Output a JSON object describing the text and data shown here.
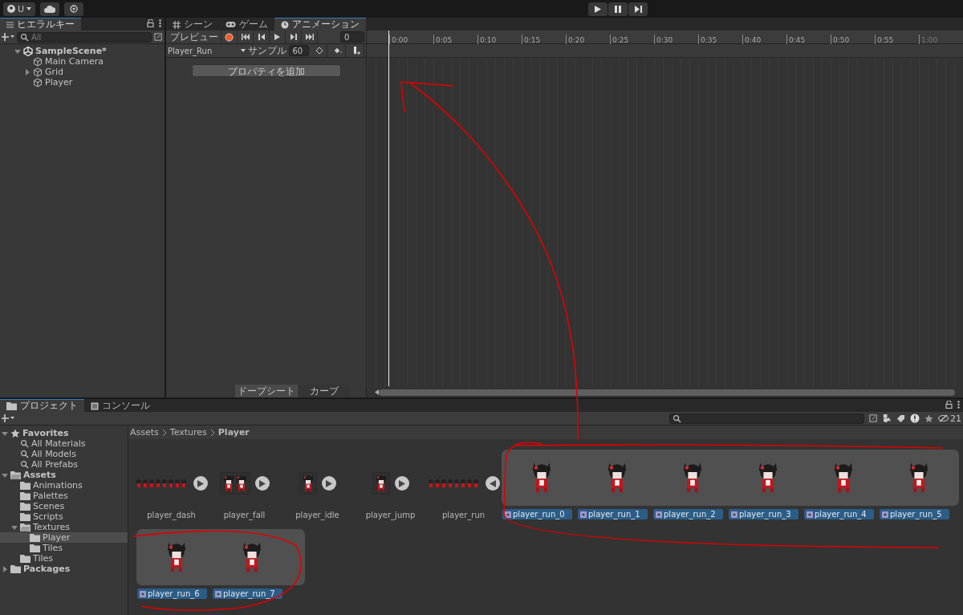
{
  "toolbar": {
    "account": "U"
  },
  "hierarchy": {
    "tab": "ヒエラルキー",
    "search": {
      "placeholder": "All"
    },
    "items": [
      {
        "label": "SampleScene*",
        "kind": "scene",
        "expanded": true,
        "children": [
          {
            "label": "Main Camera",
            "kind": "object"
          },
          {
            "label": "Grid",
            "kind": "object",
            "expanded": false
          },
          {
            "label": "Player",
            "kind": "object"
          }
        ]
      }
    ]
  },
  "animation": {
    "tabs": [
      {
        "label": "シーン",
        "kind": "scene",
        "selected": false
      },
      {
        "label": "ゲーム",
        "kind": "game",
        "selected": false
      },
      {
        "label": "アニメーション",
        "kind": "animation",
        "selected": true
      }
    ],
    "preview": "プレビュー",
    "frame": "0",
    "clip": "Player_Run",
    "sample_label": "サンプル",
    "sample": "60",
    "add_property": "プロパティを追加",
    "ruler": {
      "ticks": [
        "0:00",
        "0:05",
        "0:10",
        "0:15",
        "0:20",
        "0:25",
        "0:30",
        "0:35",
        "0:40",
        "0:45",
        "0:50",
        "0:55"
      ],
      "end_label": "1:00"
    },
    "view_tabs": [
      {
        "label": "ドープシート",
        "selected": true
      },
      {
        "label": "カーブ",
        "selected": false
      }
    ]
  },
  "project": {
    "tabs": [
      {
        "label": "プロジェクト",
        "kind": "project",
        "selected": true
      },
      {
        "label": "コンソール",
        "kind": "console",
        "selected": false
      }
    ],
    "hidden_count": "21",
    "tree": [
      {
        "label": "Favorites",
        "kind": "favorites",
        "expanded": true,
        "children": [
          {
            "label": "All Materials",
            "kind": "search"
          },
          {
            "label": "All Models",
            "kind": "search"
          },
          {
            "label": "All Prefabs",
            "kind": "search"
          }
        ]
      },
      {
        "label": "Assets",
        "kind": "root",
        "expanded": true,
        "children": [
          {
            "label": "Animations",
            "kind": "folder"
          },
          {
            "label": "Palettes",
            "kind": "folder"
          },
          {
            "label": "Scenes",
            "kind": "folder"
          },
          {
            "label": "Scripts",
            "kind": "folder"
          },
          {
            "label": "Textures",
            "kind": "folder",
            "expanded": true,
            "children": [
              {
                "label": "Player",
                "kind": "folder",
                "selected": true
              },
              {
                "label": "Tiles",
                "kind": "folder",
                "selected": false
              }
            ]
          },
          {
            "label": "Tiles",
            "kind": "folder"
          }
        ]
      },
      {
        "label": "Packages",
        "kind": "root",
        "expanded": false
      }
    ],
    "breadcrumb": [
      "Assets",
      "Textures",
      "Player"
    ],
    "assets": [
      {
        "label": "player_dash",
        "kind": "strip",
        "expanded": false
      },
      {
        "label": "player_fall",
        "kind": "pair",
        "expanded": false
      },
      {
        "label": "player_idle",
        "kind": "single",
        "expanded": false
      },
      {
        "label": "player_jump",
        "kind": "single",
        "expanded": false
      },
      {
        "label": "player_run",
        "kind": "strip",
        "expanded": true
      }
    ],
    "sprites": [
      {
        "label": "player_run_0"
      },
      {
        "label": "player_run_1"
      },
      {
        "label": "player_run_2"
      },
      {
        "label": "player_run_3"
      },
      {
        "label": "player_run_4"
      },
      {
        "label": "player_run_5"
      },
      {
        "label": "player_run_6"
      },
      {
        "label": "player_run_7"
      }
    ]
  }
}
